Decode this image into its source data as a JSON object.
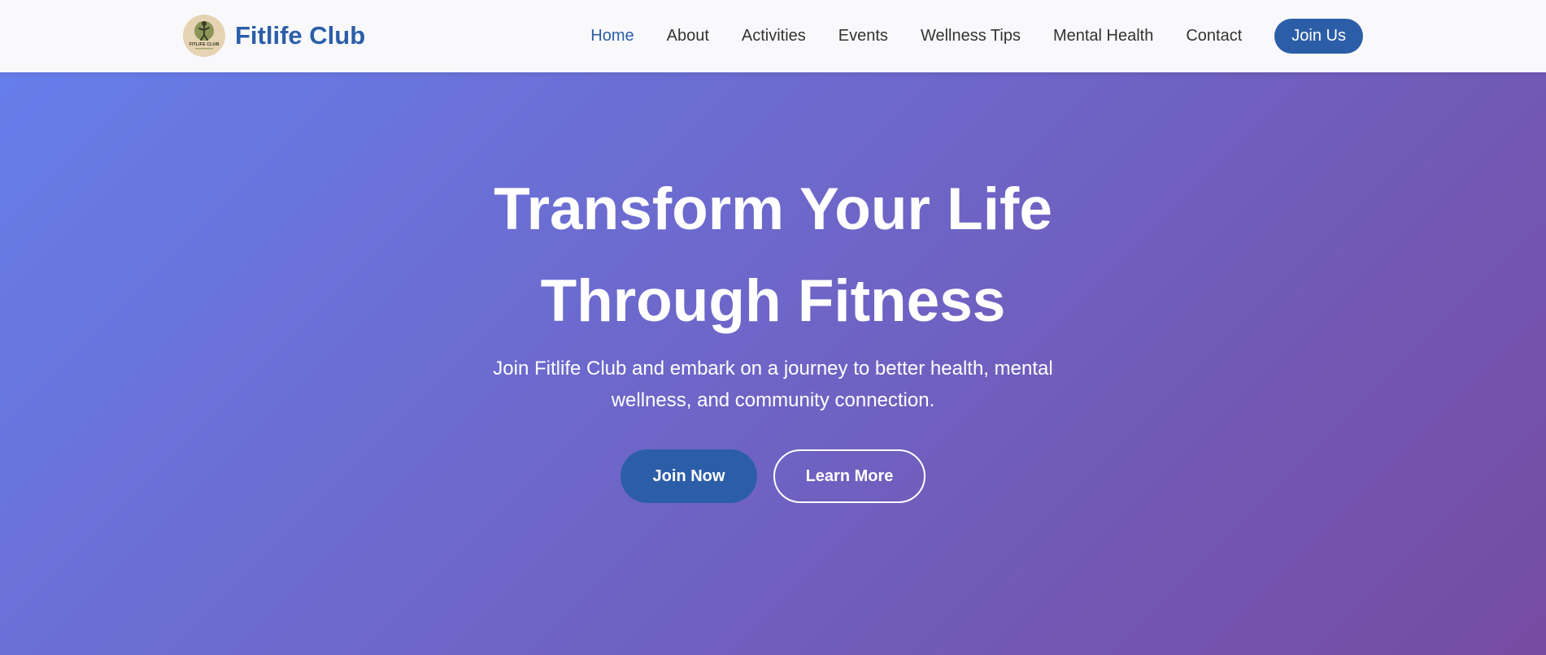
{
  "header": {
    "brand_name": "Fitlife Club",
    "logo_text": "FITLIFE CLUB",
    "nav": [
      {
        "label": "Home",
        "active": true
      },
      {
        "label": "About"
      },
      {
        "label": "Activities"
      },
      {
        "label": "Events"
      },
      {
        "label": "Wellness Tips"
      },
      {
        "label": "Mental Health"
      },
      {
        "label": "Contact"
      }
    ],
    "cta_label": "Join Us"
  },
  "hero": {
    "title_line1": "Transform Your Life",
    "title_line2": "Through Fitness",
    "subtitle": "Join Fitlife Club and embark on a journey to better health, mental wellness, and community connection.",
    "primary_button": "Join Now",
    "secondary_button": "Learn More"
  },
  "colors": {
    "brand": "#2c5ea8",
    "hero_gradient_start": "#667eea",
    "hero_gradient_end": "#764ba2",
    "header_bg": "#f9f9fc",
    "nav_text": "#333333"
  }
}
